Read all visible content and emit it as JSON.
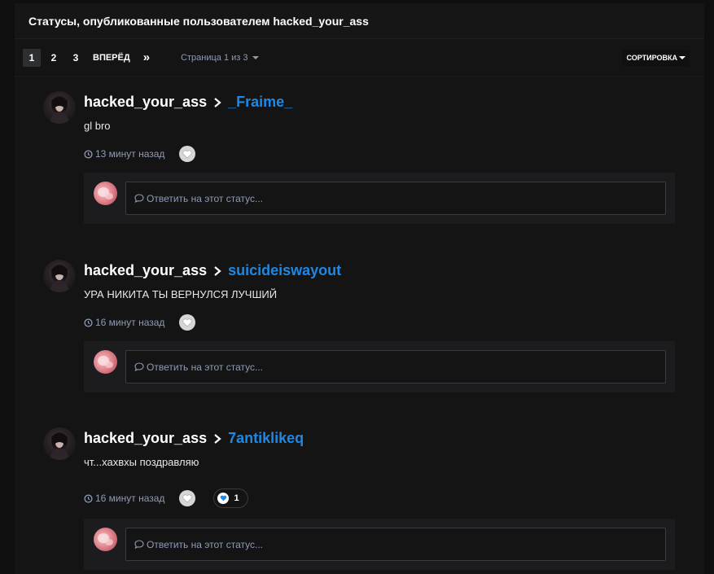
{
  "header": {
    "title": "Статусы, опубликованные пользователем hacked_your_ass"
  },
  "pagination": {
    "pages": [
      "1",
      "2",
      "3"
    ],
    "active_page": "1",
    "next_label": "ВПЕРЁД",
    "last_icon": "double-chevron-right-icon",
    "page_info": "Страница 1 из 3",
    "sort_label": "СОРТИРОВКА"
  },
  "statuses": [
    {
      "author": "hacked_your_ass",
      "target": "_Fraime_",
      "text": "gl bro",
      "time": "13 минут назад",
      "reply_placeholder": "Ответить на этот статус...",
      "reaction_count": null
    },
    {
      "author": "hacked_your_ass",
      "target": "suicideiswayout",
      "text": "УРА НИКИТА ТЫ ВЕРНУЛСЯ ЛУЧШИЙ",
      "time": "16 минут назад",
      "reply_placeholder": "Ответить на этот статус...",
      "reaction_count": null
    },
    {
      "author": "hacked_your_ass",
      "target": "7antiklikeq",
      "text": "чт...хахвхы поздравляю",
      "time": "16 минут назад",
      "reply_placeholder": "Ответить на этот статус...",
      "reaction_count": "1"
    }
  ],
  "colors": {
    "background": "#0f0f10",
    "panel": "#141415",
    "link_blue": "#1e88e5",
    "muted": "#8f9bb3",
    "reply_box": "#1c1c1e"
  }
}
